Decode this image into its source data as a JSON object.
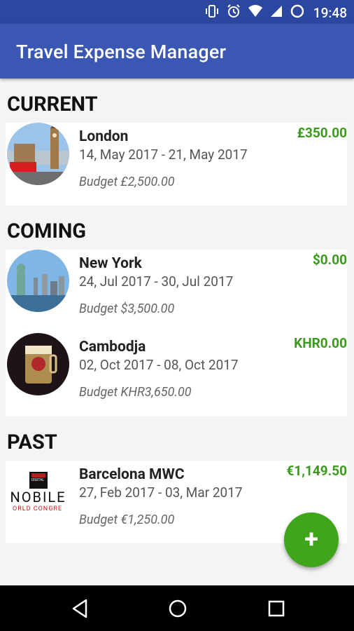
{
  "status_bar": {
    "time": "19:48",
    "icons": [
      "vibrate-icon",
      "alarm-icon",
      "wifi-icon",
      "signal-icon",
      "sync-icon"
    ]
  },
  "app_bar": {
    "title": "Travel Expense Manager"
  },
  "sections": [
    {
      "title": "CURRENT",
      "trips": [
        {
          "city": "London",
          "dates": "14, May 2017 - 21, May 2017",
          "budget": "Budget £2,500.00",
          "amount": "£350.00"
        }
      ]
    },
    {
      "title": "COMING",
      "trips": [
        {
          "city": "New York",
          "dates": "24, Jul 2017 - 30, Jul 2017",
          "budget": "Budget $3,500.00",
          "amount": "$0.00"
        },
        {
          "city": "Cambodja",
          "dates": "02, Oct 2017 - 08, Oct 2017",
          "budget": "Budget KHR3,650.00",
          "amount": "KHR0.00"
        }
      ]
    },
    {
      "title": "PAST",
      "trips": [
        {
          "city": "Barcelona MWC",
          "dates": "27, Feb 2017 - 03, Mar 2017",
          "budget": "Budget €1,250.00",
          "amount": "€1,149.50",
          "logo_text_top": "DIGITAL",
          "logo_text_main": "NOBILE",
          "logo_text_bottom": "ORLD CONGRE"
        }
      ]
    }
  ],
  "fab": {
    "label": "+"
  },
  "colors": {
    "primary": "#3a57b4",
    "primary_dark": "#2c47a0",
    "accent": "#3fa51b",
    "amount": "#3a9a1c"
  }
}
